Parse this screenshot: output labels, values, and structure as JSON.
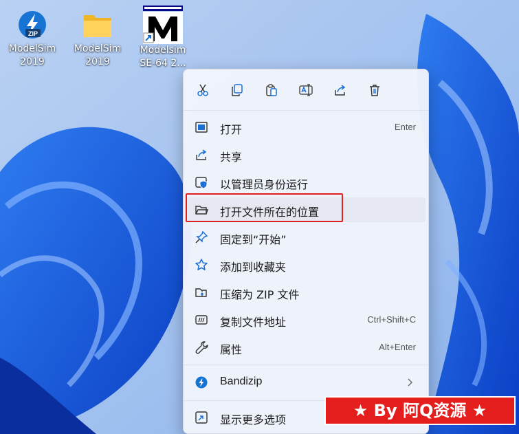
{
  "desktop": {
    "icons": [
      {
        "label": "ModelSim\n2019",
        "icon": "zip-archive-icon"
      },
      {
        "label": "ModelSim\n2019",
        "icon": "folder-icon"
      },
      {
        "label": "Modelsim\nSE-64 2...",
        "icon": "modelsim-shortcut-icon"
      }
    ]
  },
  "context_menu": {
    "toolbar": [
      "cut-icon",
      "copy-icon",
      "paste-icon",
      "rename-icon",
      "share-icon",
      "delete-icon"
    ],
    "items": [
      {
        "label": "打开",
        "shortcut": "Enter",
        "icon": "open-icon"
      },
      {
        "label": "共享",
        "shortcut": "",
        "icon": "share-icon"
      },
      {
        "label": "以管理员身份运行",
        "shortcut": "",
        "icon": "shield-icon"
      },
      {
        "label": "打开文件所在的位置",
        "shortcut": "",
        "icon": "folder-open-icon"
      },
      {
        "label": "固定到“开始”",
        "shortcut": "",
        "icon": "pin-icon"
      },
      {
        "label": "添加到收藏夹",
        "shortcut": "",
        "icon": "star-icon"
      },
      {
        "label": "压缩为 ZIP 文件",
        "shortcut": "",
        "icon": "zip-icon"
      },
      {
        "label": "复制文件地址",
        "shortcut": "Ctrl+Shift+C",
        "icon": "copy-path-icon"
      },
      {
        "label": "属性",
        "shortcut": "Alt+Enter",
        "icon": "wrench-icon"
      },
      {
        "label": "Bandizip",
        "shortcut": "",
        "icon": "bandizip-icon"
      },
      {
        "label": "显示更多选项",
        "shortcut": "",
        "icon": "more-options-icon"
      }
    ],
    "highlighted_item": "打开文件所在的位置"
  },
  "watermark": {
    "text": "★ By 阿Q资源 ★"
  },
  "colors": {
    "accent": "#1a6fd6",
    "highlight_border": "#e02020",
    "watermark_bg": "#e41d1d"
  }
}
